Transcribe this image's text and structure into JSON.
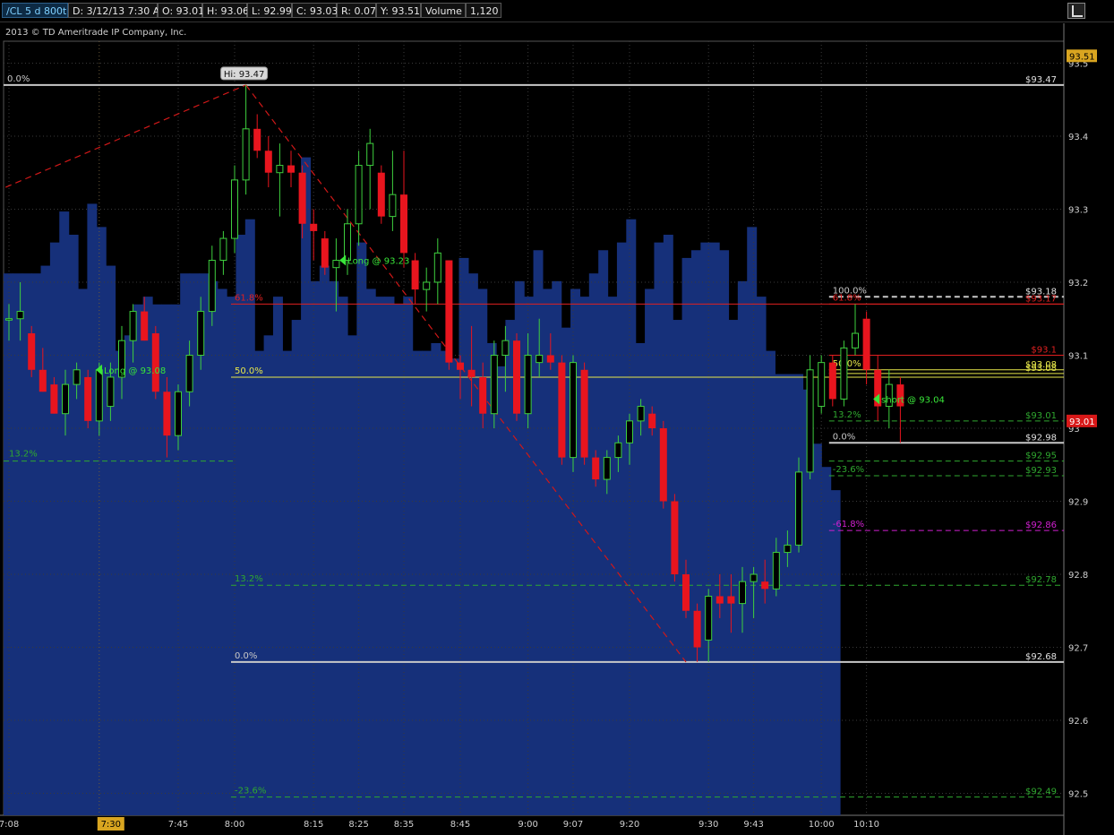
{
  "header": {
    "symbol": "/CL 5 d 800t",
    "date": "D: 3/12/13 7:30 AM",
    "open": "O: 93.01",
    "high": "H: 93.06",
    "low": "L: 92.99",
    "close": "C: 93.03",
    "range": "R: 0.07",
    "y_value": "Y: 93.51",
    "volume_label": "Volume",
    "volume_value": "1,120"
  },
  "copyright": "2013 © TD Ameritrade IP Company, Inc.",
  "colors": {
    "up": "#3ecf3e",
    "down": "#e8151e",
    "volume": "#16307a",
    "fib_white": "#c8c8c8",
    "fib_red": "#e02020",
    "fib_yellow": "#e8e84a",
    "fib_green": "#2fa82f",
    "fib_magenta": "#d020d0",
    "tag_gold": "#d9a520",
    "tag_red": "#d81818"
  },
  "chart_data": {
    "type": "candlestick",
    "ylim": [
      92.47,
      93.53
    ],
    "y_ticks": [
      "93.5",
      "93.4",
      "93.3",
      "93.2",
      "93.1",
      "93",
      "92.9",
      "92.8",
      "92.7",
      "92.6",
      "92.5"
    ],
    "x_ticks": [
      "7:08",
      "7:30",
      "7:45",
      "8:00",
      "8:15",
      "8:25",
      "8:35",
      "8:45",
      "9:00",
      "9:07",
      "9:20",
      "9:30",
      "9:43",
      "10:00",
      "10:10"
    ],
    "x_ticks_idx": [
      0,
      8,
      15,
      20,
      27,
      31,
      35,
      40,
      46,
      50,
      55,
      62,
      66,
      72,
      76
    ],
    "highlight_tick_idx": 1,
    "candles": [
      {
        "o": 93.15,
        "h": 93.17,
        "l": 93.12,
        "c": 93.15
      },
      {
        "o": 93.15,
        "h": 93.2,
        "l": 93.12,
        "c": 93.16
      },
      {
        "o": 93.13,
        "h": 93.14,
        "l": 93.07,
        "c": 93.08
      },
      {
        "o": 93.08,
        "h": 93.11,
        "l": 93.05,
        "c": 93.05
      },
      {
        "o": 93.06,
        "h": 93.07,
        "l": 93.02,
        "c": 93.02
      },
      {
        "o": 93.02,
        "h": 93.08,
        "l": 92.99,
        "c": 93.06
      },
      {
        "o": 93.06,
        "h": 93.09,
        "l": 93.04,
        "c": 93.08
      },
      {
        "o": 93.07,
        "h": 93.08,
        "l": 93.0,
        "c": 93.01
      },
      {
        "o": 93.01,
        "h": 93.09,
        "l": 92.99,
        "c": 93.08
      },
      {
        "o": 93.03,
        "h": 93.09,
        "l": 93.01,
        "c": 93.07
      },
      {
        "o": 93.07,
        "h": 93.14,
        "l": 93.04,
        "c": 93.12
      },
      {
        "o": 93.12,
        "h": 93.17,
        "l": 93.09,
        "c": 93.16
      },
      {
        "o": 93.16,
        "h": 93.18,
        "l": 93.12,
        "c": 93.12
      },
      {
        "o": 93.13,
        "h": 93.14,
        "l": 93.04,
        "c": 93.05
      },
      {
        "o": 93.05,
        "h": 93.07,
        "l": 92.96,
        "c": 92.99
      },
      {
        "o": 92.99,
        "h": 93.06,
        "l": 92.97,
        "c": 93.05
      },
      {
        "o": 93.05,
        "h": 93.12,
        "l": 93.03,
        "c": 93.1
      },
      {
        "o": 93.1,
        "h": 93.18,
        "l": 93.08,
        "c": 93.16
      },
      {
        "o": 93.16,
        "h": 93.25,
        "l": 93.14,
        "c": 93.23
      },
      {
        "o": 93.23,
        "h": 93.27,
        "l": 93.21,
        "c": 93.26
      },
      {
        "o": 93.26,
        "h": 93.36,
        "l": 93.24,
        "c": 93.34
      },
      {
        "o": 93.34,
        "h": 93.47,
        "l": 93.32,
        "c": 93.41
      },
      {
        "o": 93.41,
        "h": 93.43,
        "l": 93.37,
        "c": 93.38
      },
      {
        "o": 93.38,
        "h": 93.4,
        "l": 93.33,
        "c": 93.35
      },
      {
        "o": 93.35,
        "h": 93.39,
        "l": 93.29,
        "c": 93.36
      },
      {
        "o": 93.36,
        "h": 93.38,
        "l": 93.33,
        "c": 93.35
      },
      {
        "o": 93.35,
        "h": 93.36,
        "l": 93.26,
        "c": 93.28
      },
      {
        "o": 93.28,
        "h": 93.3,
        "l": 93.23,
        "c": 93.27
      },
      {
        "o": 93.26,
        "h": 93.27,
        "l": 93.21,
        "c": 93.22
      },
      {
        "o": 93.22,
        "h": 93.26,
        "l": 93.16,
        "c": 93.23
      },
      {
        "o": 93.23,
        "h": 93.3,
        "l": 93.21,
        "c": 93.28
      },
      {
        "o": 93.28,
        "h": 93.38,
        "l": 93.25,
        "c": 93.36
      },
      {
        "o": 93.36,
        "h": 93.41,
        "l": 93.3,
        "c": 93.39
      },
      {
        "o": 93.35,
        "h": 93.36,
        "l": 93.28,
        "c": 93.29
      },
      {
        "o": 93.29,
        "h": 93.38,
        "l": 93.27,
        "c": 93.32
      },
      {
        "o": 93.32,
        "h": 93.38,
        "l": 93.22,
        "c": 93.24
      },
      {
        "o": 93.23,
        "h": 93.24,
        "l": 93.17,
        "c": 93.19
      },
      {
        "o": 93.19,
        "h": 93.22,
        "l": 93.16,
        "c": 93.2
      },
      {
        "o": 93.2,
        "h": 93.26,
        "l": 93.17,
        "c": 93.24
      },
      {
        "o": 93.23,
        "h": 93.23,
        "l": 93.08,
        "c": 93.09
      },
      {
        "o": 93.09,
        "h": 93.1,
        "l": 93.04,
        "c": 93.08
      },
      {
        "o": 93.08,
        "h": 93.14,
        "l": 93.03,
        "c": 93.07
      },
      {
        "o": 93.07,
        "h": 93.09,
        "l": 93.0,
        "c": 93.02
      },
      {
        "o": 93.02,
        "h": 93.12,
        "l": 93.0,
        "c": 93.1
      },
      {
        "o": 93.1,
        "h": 93.14,
        "l": 93.05,
        "c": 93.12
      },
      {
        "o": 93.12,
        "h": 93.13,
        "l": 93.01,
        "c": 93.02
      },
      {
        "o": 93.02,
        "h": 93.13,
        "l": 93.0,
        "c": 93.1
      },
      {
        "o": 93.09,
        "h": 93.15,
        "l": 93.07,
        "c": 93.1
      },
      {
        "o": 93.1,
        "h": 93.13,
        "l": 93.08,
        "c": 93.09
      },
      {
        "o": 93.09,
        "h": 93.1,
        "l": 92.95,
        "c": 92.96
      },
      {
        "o": 92.96,
        "h": 93.1,
        "l": 92.94,
        "c": 93.09
      },
      {
        "o": 93.08,
        "h": 93.09,
        "l": 92.95,
        "c": 92.96
      },
      {
        "o": 92.96,
        "h": 92.97,
        "l": 92.92,
        "c": 92.93
      },
      {
        "o": 92.93,
        "h": 92.97,
        "l": 92.91,
        "c": 92.96
      },
      {
        "o": 92.96,
        "h": 92.99,
        "l": 92.94,
        "c": 92.98
      },
      {
        "o": 92.98,
        "h": 93.02,
        "l": 92.95,
        "c": 93.01
      },
      {
        "o": 93.01,
        "h": 93.04,
        "l": 92.99,
        "c": 93.03
      },
      {
        "o": 93.02,
        "h": 93.03,
        "l": 92.99,
        "c": 93.0
      },
      {
        "o": 93.0,
        "h": 93.01,
        "l": 92.89,
        "c": 92.9
      },
      {
        "o": 92.9,
        "h": 92.91,
        "l": 92.79,
        "c": 92.8
      },
      {
        "o": 92.8,
        "h": 92.82,
        "l": 92.74,
        "c": 92.75
      },
      {
        "o": 92.75,
        "h": 92.76,
        "l": 92.68,
        "c": 92.7
      },
      {
        "o": 92.71,
        "h": 92.78,
        "l": 92.68,
        "c": 92.77
      },
      {
        "o": 92.77,
        "h": 92.8,
        "l": 92.74,
        "c": 92.76
      },
      {
        "o": 92.77,
        "h": 92.8,
        "l": 92.72,
        "c": 92.76
      },
      {
        "o": 92.76,
        "h": 92.81,
        "l": 92.72,
        "c": 92.79
      },
      {
        "o": 92.79,
        "h": 92.81,
        "l": 92.74,
        "c": 92.8
      },
      {
        "o": 92.79,
        "h": 92.82,
        "l": 92.76,
        "c": 92.78
      },
      {
        "o": 92.78,
        "h": 92.85,
        "l": 92.77,
        "c": 92.83
      },
      {
        "o": 92.83,
        "h": 92.86,
        "l": 92.81,
        "c": 92.84
      },
      {
        "o": 92.84,
        "h": 92.96,
        "l": 92.83,
        "c": 92.94
      },
      {
        "o": 92.94,
        "h": 93.1,
        "l": 92.93,
        "c": 93.08
      },
      {
        "o": 93.03,
        "h": 93.1,
        "l": 93.02,
        "c": 93.09
      },
      {
        "o": 93.09,
        "h": 93.1,
        "l": 93.03,
        "c": 93.04
      },
      {
        "o": 93.04,
        "h": 93.12,
        "l": 93.03,
        "c": 93.11
      },
      {
        "o": 93.11,
        "h": 93.17,
        "l": 93.1,
        "c": 93.13
      },
      {
        "o": 93.15,
        "h": 93.16,
        "l": 93.06,
        "c": 93.08
      },
      {
        "o": 93.08,
        "h": 93.1,
        "l": 93.01,
        "c": 93.03
      },
      {
        "o": 93.03,
        "h": 93.08,
        "l": 93.0,
        "c": 93.06
      },
      {
        "o": 93.06,
        "h": 93.07,
        "l": 92.98,
        "c": 93.03
      }
    ],
    "volume_level": [
      0.7,
      0.7,
      0.7,
      0.7,
      0.71,
      0.74,
      0.78,
      0.75,
      0.68,
      0.79,
      0.76,
      0.71,
      0.6,
      0.62,
      0.66,
      0.67,
      0.66,
      0.66,
      0.66,
      0.7,
      0.7,
      0.7,
      0.69,
      0.68,
      0.67,
      0.75,
      0.77,
      0.6,
      0.62,
      0.67,
      0.6,
      0.64,
      0.85,
      0.69,
      0.71,
      0.69,
      0.67,
      0.62,
      0.74,
      0.68,
      0.67,
      0.67,
      0.66,
      0.67,
      0.6,
      0.6,
      0.61,
      0.6,
      0.59,
      0.72,
      0.7,
      0.68,
      0.61,
      0.58,
      0.64,
      0.69,
      0.67,
      0.73,
      0.68,
      0.69,
      0.63,
      0.68,
      0.67,
      0.7,
      0.73,
      0.67,
      0.74,
      0.77,
      0.61,
      0.68,
      0.74,
      0.75,
      0.64,
      0.72,
      0.73,
      0.74,
      0.74,
      0.73,
      0.64,
      0.69,
      0.76,
      0.67,
      0.6,
      0.57,
      0.57,
      0.57,
      0.55,
      0.48,
      0.45,
      0.42
    ],
    "fib_sets": [
      {
        "x_start_idx": 20,
        "levels": [
          {
            "label": "0.0%",
            "price": 93.47,
            "price_label": "$93.47",
            "color": "fib_white",
            "style": "solid",
            "x_from": "left"
          },
          {
            "label": "61.8%",
            "price": 93.17,
            "price_label": "",
            "color": "fib_red",
            "style": "solid"
          },
          {
            "label": "50.0%",
            "price": 93.07,
            "price_label": "",
            "color": "fib_yellow",
            "style": "solid"
          },
          {
            "label": "13.2%",
            "price": 92.785,
            "price_label": "$92.78",
            "color": "fib_green",
            "style": "dashed"
          },
          {
            "label": "0.0%",
            "price": 92.68,
            "price_label": "$92.68",
            "color": "fib_white",
            "style": "solid"
          },
          {
            "label": "-23.6%",
            "price": 92.495,
            "price_label": "$92.49",
            "color": "fib_green",
            "style": "dashed"
          }
        ]
      },
      {
        "x_start_idx": 73,
        "levels": [
          {
            "label": "100.0%",
            "price": 93.18,
            "price_label": "$93.18",
            "color": "fib_white",
            "style": "dashed"
          },
          {
            "label": "61.8%",
            "price": 93.17,
            "price_label": "$93.17",
            "color": "fib_red",
            "style": "solid"
          },
          {
            "label": "",
            "price": 93.1,
            "price_label": "$93.1",
            "color": "fib_red",
            "style": "solid"
          },
          {
            "label": "50.0%",
            "price": 93.08,
            "price_label": "$93.08",
            "color": "fib_yellow",
            "style": "solid"
          },
          {
            "label": "",
            "price": 93.075,
            "price_label": "$93.08",
            "color": "fib_yellow",
            "style": "solid"
          },
          {
            "label": "13.2%",
            "price": 93.01,
            "price_label": "$93.01",
            "color": "fib_green",
            "style": "dashed"
          },
          {
            "label": "0.0%",
            "price": 92.98,
            "price_label": "$92.98",
            "color": "fib_white",
            "style": "solid"
          },
          {
            "label": "",
            "price": 92.955,
            "price_label": "$92.95",
            "color": "fib_green",
            "style": "dashed"
          },
          {
            "label": "-23.6%",
            "price": 92.935,
            "price_label": "$92.93",
            "color": "fib_green",
            "style": "dashed"
          },
          {
            "label": "-61.8%",
            "price": 92.86,
            "price_label": "$92.86",
            "color": "fib_magenta",
            "style": "dashed"
          }
        ]
      }
    ],
    "left_fib_label": {
      "label": "13.2%",
      "price": 92.955
    },
    "trend_lines": [
      {
        "from": {
          "idx": -0.3,
          "price": 93.33
        },
        "to": {
          "idx": 21,
          "price": 93.47
        }
      },
      {
        "from": {
          "idx": 21,
          "price": 93.47
        },
        "to": {
          "idx": 60,
          "price": 92.68
        }
      }
    ],
    "annotations": [
      {
        "text": "Hi: 93.47",
        "idx": 21,
        "price": 93.47,
        "kind": "hi"
      },
      {
        "text": "Long @ 93.08",
        "idx": 7.7,
        "price": 93.08,
        "kind": "arrow-left"
      },
      {
        "text": "Long @ 93.23",
        "idx": 29.3,
        "price": 93.23,
        "kind": "arrow-left"
      },
      {
        "text": "short @ 93.04",
        "idx": 76.6,
        "price": 93.04,
        "kind": "arrow-left"
      }
    ],
    "price_tags": [
      {
        "text": "93.51",
        "price": 93.51,
        "color": "tag_gold"
      },
      {
        "text": "93.01",
        "price": 93.01,
        "color": "tag_red"
      }
    ]
  }
}
